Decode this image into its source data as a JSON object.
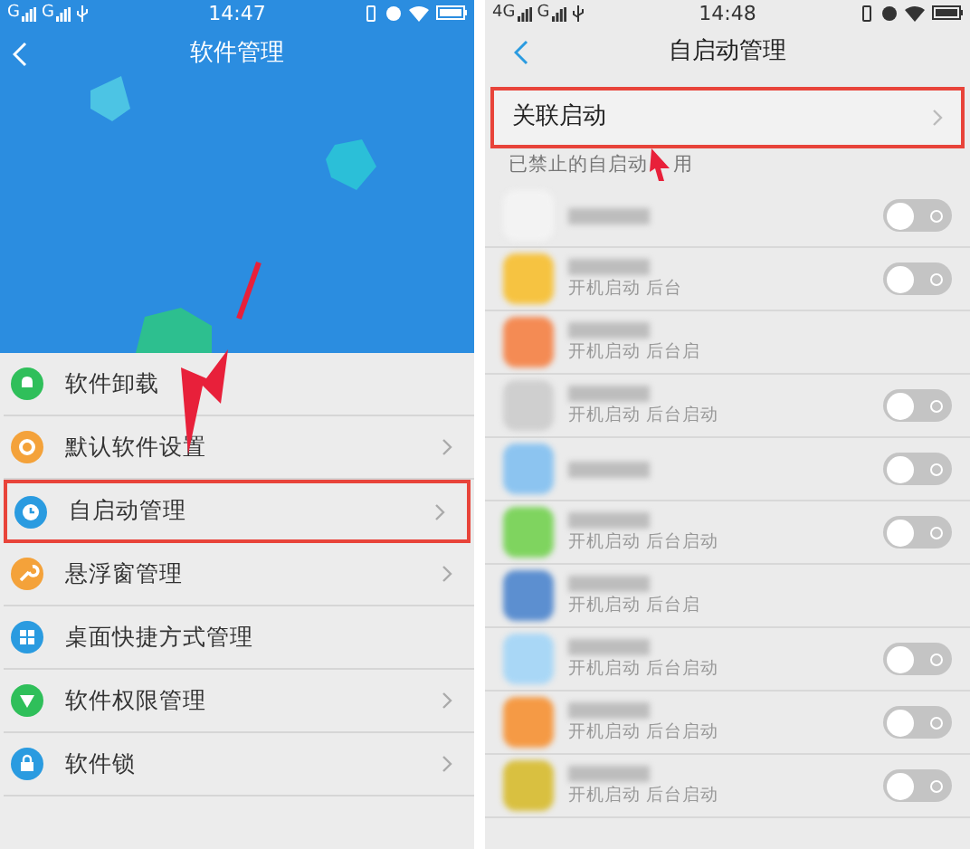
{
  "left_screen": {
    "status_bar": {
      "signals": [
        "G",
        "G"
      ],
      "time": "14:47"
    },
    "title": "软件管理",
    "menu": [
      {
        "label": "软件卸载",
        "color": "#2fbf5a",
        "chevron": false,
        "highlighted": false
      },
      {
        "label": "默认软件设置",
        "color": "#f4a23a",
        "chevron": true,
        "highlighted": false
      },
      {
        "label": "自启动管理",
        "color": "#2a9be0",
        "chevron": true,
        "highlighted": true
      },
      {
        "label": "悬浮窗管理",
        "color": "#f4a23a",
        "chevron": true,
        "highlighted": false
      },
      {
        "label": "桌面快捷方式管理",
        "color": "#2a9be0",
        "chevron": false,
        "highlighted": false
      },
      {
        "label": "软件权限管理",
        "color": "#2fbf5a",
        "chevron": true,
        "highlighted": false
      },
      {
        "label": "软件锁",
        "color": "#2a9be0",
        "chevron": true,
        "highlighted": false
      }
    ]
  },
  "right_screen": {
    "status_bar": {
      "signals": [
        "4G",
        "G"
      ],
      "time": "14:48"
    },
    "title": "自启动管理",
    "linked_row": {
      "label": "关联启动",
      "highlighted": true
    },
    "section_label": [
      "已禁止的自启动",
      "用"
    ],
    "apps": [
      {
        "kind": "toggle",
        "color": "#f3f3f3",
        "on": false
      },
      {
        "kind": "toggle",
        "color": "#f6c341",
        "subtitle": "开机启动 后台",
        "on": false
      },
      {
        "kind": "plain",
        "color": "#f48b54",
        "subtitle": "开机启动 后台启"
      },
      {
        "kind": "toggle",
        "color": "#cfcfcf",
        "subtitle": "开机启动 后台启动",
        "on": false
      },
      {
        "kind": "toggle",
        "color": "#8cc4f0",
        "on": false
      },
      {
        "kind": "toggle",
        "color": "#7fd45f",
        "subtitle": "开机启动 后台启动",
        "on": false
      },
      {
        "kind": "plain",
        "color": "#5c8fd0",
        "subtitle": "开机启动 后台启"
      },
      {
        "kind": "toggle",
        "color": "#a9d7f6",
        "subtitle": "开机启动 后台启动",
        "on": false
      },
      {
        "kind": "toggle",
        "color": "#f59a45",
        "subtitle": "开机启动 后台启动",
        "on": false
      },
      {
        "kind": "toggle",
        "color": "#d9c040",
        "subtitle": "开机启动 后台启动",
        "on": false
      }
    ]
  }
}
